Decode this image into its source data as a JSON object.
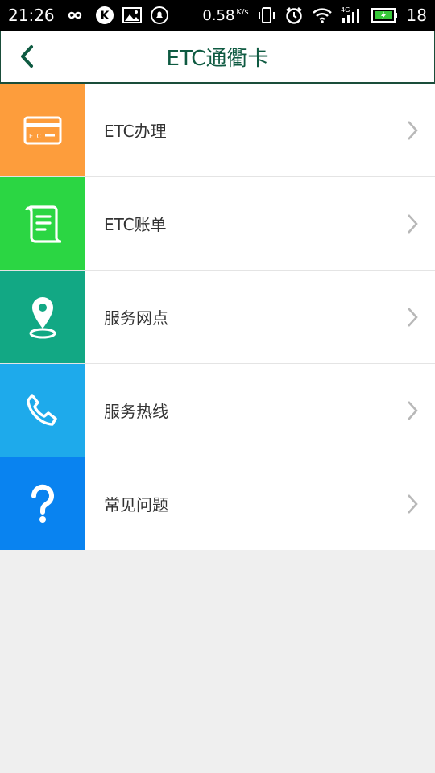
{
  "status_bar": {
    "time": "21:26",
    "net_speed": "0.58",
    "net_speed_unit": "K/s",
    "network_type": "4G",
    "battery_level": "18"
  },
  "header": {
    "title": "ETC通衢卡",
    "back_icon": "chevron-left-icon"
  },
  "menu": {
    "items": [
      {
        "label": "ETC办理",
        "icon": "etc-card-icon",
        "color": "#fd9d3c"
      },
      {
        "label": "ETC账单",
        "icon": "bill-scroll-icon",
        "color": "#2bd643"
      },
      {
        "label": "服务网点",
        "icon": "location-pin-icon",
        "color": "#12a884"
      },
      {
        "label": "服务热线",
        "icon": "phone-icon",
        "color": "#1eaaeb"
      },
      {
        "label": "常见问题",
        "icon": "question-icon",
        "color": "#0983f0"
      }
    ]
  },
  "colors": {
    "title": "#0e5a41",
    "background": "#efefef"
  }
}
